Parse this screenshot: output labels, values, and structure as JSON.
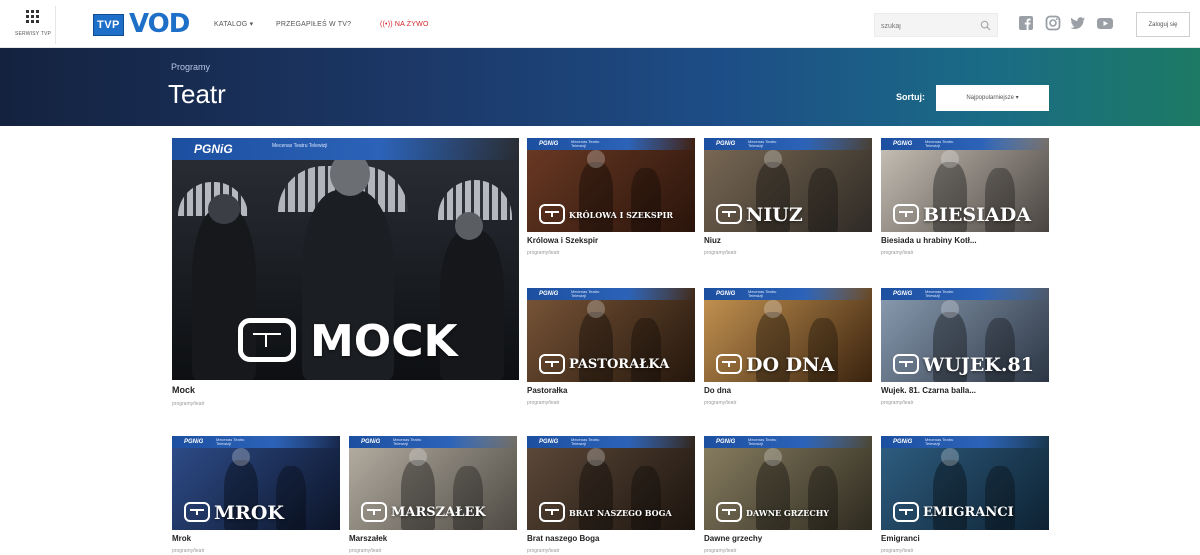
{
  "services": {
    "label": "SERWISY TVP"
  },
  "logo": {
    "tvp": "TVP",
    "vod": "VOD"
  },
  "nav": {
    "catalog": "KATALOG ▾",
    "missed": "PRZEGAPIŁEŚ W TV?",
    "live": "((•)) NA ŻYWO"
  },
  "search": {
    "placeholder": "szukaj"
  },
  "social": [
    "facebook-icon",
    "instagram-icon",
    "twitter-icon",
    "youtube-icon"
  ],
  "login": {
    "label": "Zaloguj się"
  },
  "hero": {
    "breadcrumb": "Programy",
    "title": "Teatr",
    "sort_label": "Sortuj:",
    "sort_value": "Najpopularniejsze ▾"
  },
  "sponsor": {
    "name": "PGNiG",
    "tagline": "Mecenas Teatru Telewizji"
  },
  "featured": {
    "title": "Mock",
    "category": "programy/teatr",
    "overlay": "MOCK",
    "colors": [
      "#2b2f36",
      "#0d0f12"
    ]
  },
  "tiles": [
    {
      "title": "Królowa i Szekspir",
      "category": "programy/teatr",
      "overlay": "KRÓLOWA I SZEKSPIR",
      "colors": [
        "#6b3a24",
        "#2a140b"
      ]
    },
    {
      "title": "Niuz",
      "category": "programy/teatr",
      "overlay": "NIUZ",
      "colors": [
        "#7b6a55",
        "#2e2a25"
      ]
    },
    {
      "title": "Biesiada u hrabiny Kotł...",
      "category": "programy/teatr",
      "overlay": "BIESIADA",
      "colors": [
        "#c8c2b8",
        "#4a4440"
      ]
    },
    {
      "title": "Pastorałka",
      "category": "programy/teatr",
      "overlay": "PASTORAŁKA",
      "colors": [
        "#7a5638",
        "#24160c"
      ]
    },
    {
      "title": "Do dna",
      "category": "programy/teatr",
      "overlay": "DO DNA",
      "colors": [
        "#c79552",
        "#3a230f"
      ]
    },
    {
      "title": "Wujek. 81. Czarna balla...",
      "category": "programy/teatr",
      "overlay": "WUJEK.81",
      "colors": [
        "#8b9db3",
        "#2c3644"
      ]
    },
    {
      "title": "Mrok",
      "category": "programy/teatr",
      "overlay": "MROK",
      "colors": [
        "#2f4e8c",
        "#0c1428"
      ]
    },
    {
      "title": "Marszałek",
      "category": "programy/teatr",
      "overlay": "MARSZAŁEK",
      "colors": [
        "#b6b0a4",
        "#4e4a43"
      ]
    },
    {
      "title": "Brat naszego Boga",
      "category": "programy/teatr",
      "overlay": "BRAT NASZEGO BOGA",
      "colors": [
        "#5e4a3a",
        "#1c140e"
      ]
    },
    {
      "title": "Dawne grzechy",
      "category": "programy/teatr",
      "overlay": "DAWNE GRZECHY",
      "colors": [
        "#8a7f62",
        "#2d2a1f"
      ]
    },
    {
      "title": "Emigranci",
      "category": "programy/teatr",
      "overlay": "EMIGRANCI",
      "colors": [
        "#2f5f82",
        "#0e2233"
      ]
    }
  ]
}
